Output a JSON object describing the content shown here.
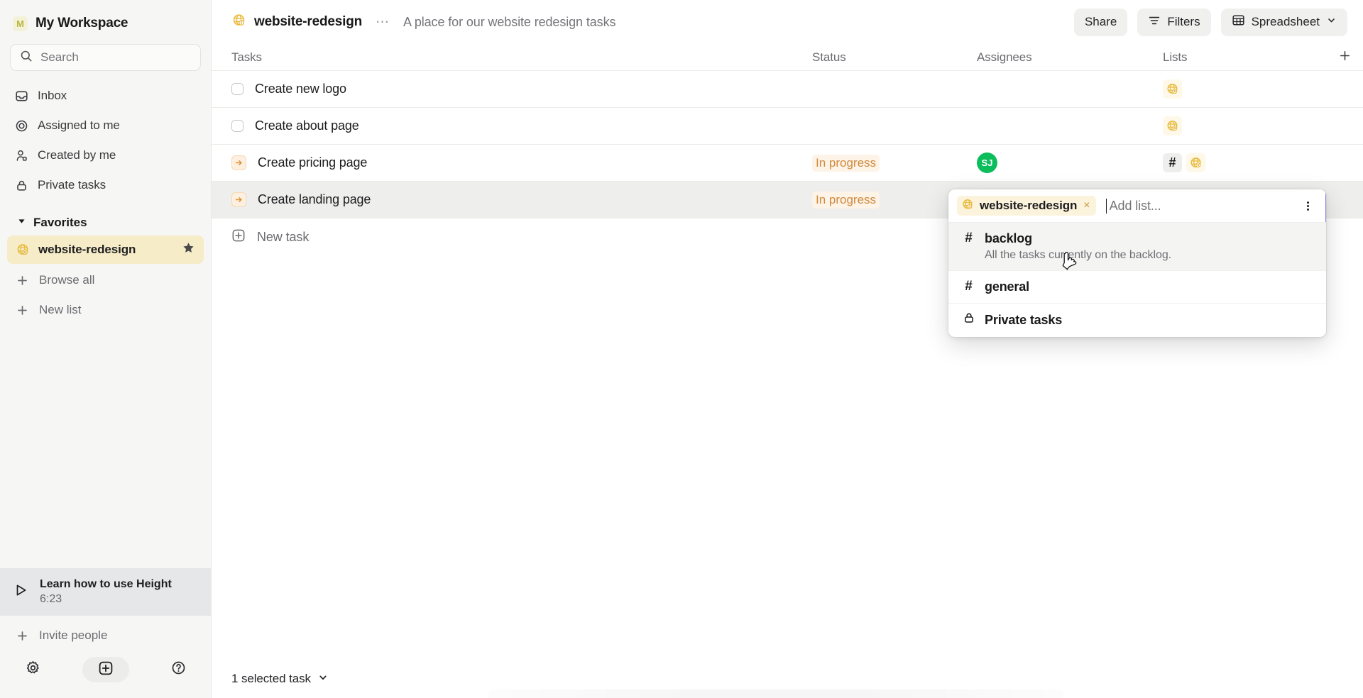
{
  "sidebar": {
    "workspace": {
      "avatar_letter": "M",
      "name": "My Workspace"
    },
    "search": {
      "placeholder": "Search",
      "icon": "search-icon"
    },
    "nav_items": [
      {
        "label": "Inbox",
        "icon": "inbox-icon"
      },
      {
        "label": "Assigned to me",
        "icon": "target-icon"
      },
      {
        "label": "Created by me",
        "icon": "person-icon"
      },
      {
        "label": "Private tasks",
        "icon": "lock-icon"
      }
    ],
    "favorites": {
      "label": "Favorites",
      "icon": "chevron-down-icon"
    },
    "favorite_items": [
      {
        "label": "website-redesign",
        "icon": "globe-icon",
        "star_icon": "star-icon",
        "active": true
      }
    ],
    "actions": [
      {
        "label": "Browse all",
        "icon": "plus-icon"
      },
      {
        "label": "New list",
        "icon": "plus-icon"
      }
    ],
    "learn_card": {
      "title": "Learn how to use Height",
      "duration": "6:23",
      "icon": "play-icon"
    },
    "invite": {
      "label": "Invite people",
      "icon": "plus-icon"
    },
    "footer_icons": [
      {
        "name": "gear-icon"
      },
      {
        "name": "plus-box-icon"
      },
      {
        "name": "help-icon"
      }
    ]
  },
  "topbar": {
    "list_icon": "globe-icon",
    "list_name": "website-redesign",
    "more_dots": "…",
    "description": "A place for our website redesign tasks",
    "share_label": "Share",
    "filters_label": "Filters",
    "filters_icon": "filter-icon",
    "view_label": "Spreadsheet",
    "view_icon": "table-icon",
    "view_chevron": "chevron-down-icon"
  },
  "table": {
    "columns": [
      "Tasks",
      "Status",
      "Assignees",
      "Lists"
    ],
    "add_column_icon": "plus-icon",
    "rows": [
      {
        "title": "Create new logo",
        "marker": "checkbox",
        "status": "",
        "assignees": [],
        "lists": [
          {
            "type": "globe",
            "label": ""
          }
        ],
        "selected": false
      },
      {
        "title": "Create about page",
        "marker": "checkbox",
        "status": "",
        "assignees": [],
        "lists": [
          {
            "type": "globe",
            "label": ""
          }
        ],
        "selected": false
      },
      {
        "title": "Create pricing page",
        "marker": "in-progress",
        "status": "In progress",
        "assignees": [
          {
            "initials": "SJ",
            "color": "#0bbd5b"
          }
        ],
        "lists": [
          {
            "type": "hash",
            "label": "#"
          },
          {
            "type": "globe",
            "label": ""
          }
        ],
        "selected": false
      },
      {
        "title": "Create landing page",
        "marker": "in-progress",
        "status": "In progress",
        "assignees": [],
        "lists": [],
        "selected": true
      }
    ],
    "new_task": {
      "label": "New task",
      "icon": "plus-box-icon"
    }
  },
  "dropdown": {
    "token": {
      "label": "website-redesign",
      "icon": "globe-icon",
      "remove_icon": "close-icon"
    },
    "input_placeholder": "Add list...",
    "kebab_icon": "kebab-menu-icon",
    "options": [
      {
        "name": "backlog",
        "icon": "hash-icon",
        "description": "All the tasks currently on the backlog.",
        "hovered": true
      },
      {
        "name": "general",
        "icon": "hash-icon",
        "description": "",
        "hovered": false
      },
      {
        "name": "Private tasks",
        "icon": "lock-icon",
        "description": "",
        "hovered": false
      }
    ]
  },
  "bottombar": {
    "selection_label": "1 selected task",
    "chevron": "chevron-down-icon"
  },
  "colors": {
    "accent_yellow": "#e8b93a",
    "status_orange": "#d08a3e",
    "avatar_green": "#0bbd5b",
    "focus_purple": "#8a7fe8",
    "sidebar_bg": "#f6f6f5",
    "favorite_bg": "#f6ecc8"
  }
}
